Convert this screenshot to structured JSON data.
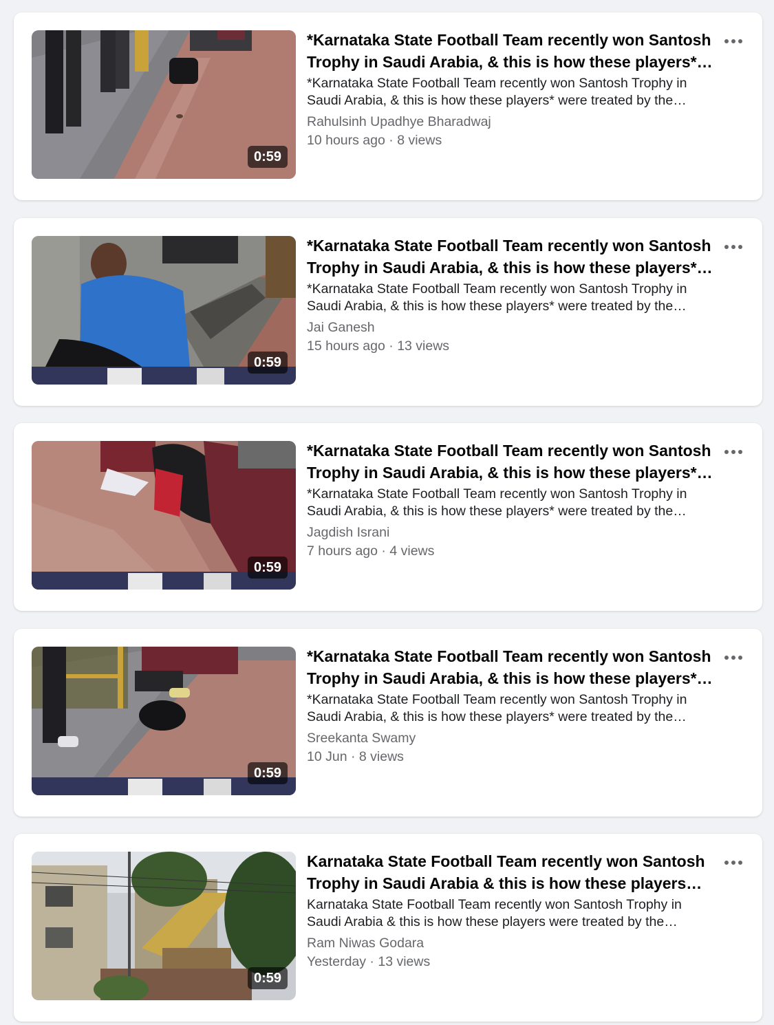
{
  "videos": [
    {
      "title": "*Karnataka State Football Team recently won Santosh Trophy in Saudi Arabia, & this is how these players* were treated by the Congress Government in Bengaluru",
      "description": "*Karnataka State Football Team recently won Santosh Trophy in Saudi Arabia, & this is how these players* were treated by the Congress Government in Bengaluru",
      "author": "Rahulsinh Upadhye Bharadwaj",
      "time": "10 hours ago",
      "views": "8 views",
      "duration": "0:59",
      "thumb_icon": "video-thumbnail-sidewalk"
    },
    {
      "title": "*Karnataka State Football Team recently won Santosh Trophy in Saudi Arabia, & this is how these players* were treated by the Congress Government in Bengaluru",
      "description": "*Karnataka State Football Team recently won Santosh Trophy in Saudi Arabia, & this is how these players* were treated by the Congress Government in Bengaluru",
      "author": "Jai Ganesh",
      "time": "15 hours ago",
      "views": "13 views",
      "duration": "0:59",
      "thumb_icon": "video-thumbnail-blue-shirt"
    },
    {
      "title": "*Karnataka State Football Team recently won Santosh Trophy in Saudi Arabia, & this is how these players* were treated by the Congress Government in Bengaluru",
      "description": "*Karnataka State Football Team recently won Santosh Trophy in Saudi Arabia, & this is how these players* were treated by the Congress Government in Bengaluru",
      "author": "Jagdish Israni",
      "time": "7 hours ago",
      "views": "4 views",
      "duration": "0:59",
      "thumb_icon": "video-thumbnail-maroon-jersey"
    },
    {
      "title": "*Karnataka State Football Team recently won Santosh Trophy in Saudi Arabia, & this is how these players* were treated by the Congress Government in Bengaluru",
      "description": "*Karnataka State Football Team recently won Santosh Trophy in Saudi Arabia, & this is how these players* were treated by the Congress Government in Bengaluru",
      "author": "Sreekanta Swamy",
      "time": "10 Jun",
      "views": "8 views",
      "duration": "0:59",
      "thumb_icon": "video-thumbnail-bag"
    },
    {
      "title": "Karnataka State Football Team recently won Santosh Trophy in Saudi Arabia & this is how these players were treated by the Congress Government in Bengaluru",
      "description": "Karnataka State Football Team recently won Santosh Trophy in Saudi Arabia & this is how these players were treated by the Congress Government in Bengaluru",
      "author": "Ram Niwas Godara",
      "time": "Yesterday",
      "views": "13 views",
      "duration": "0:59",
      "thumb_icon": "video-thumbnail-building"
    }
  ],
  "meta_separator": " · "
}
